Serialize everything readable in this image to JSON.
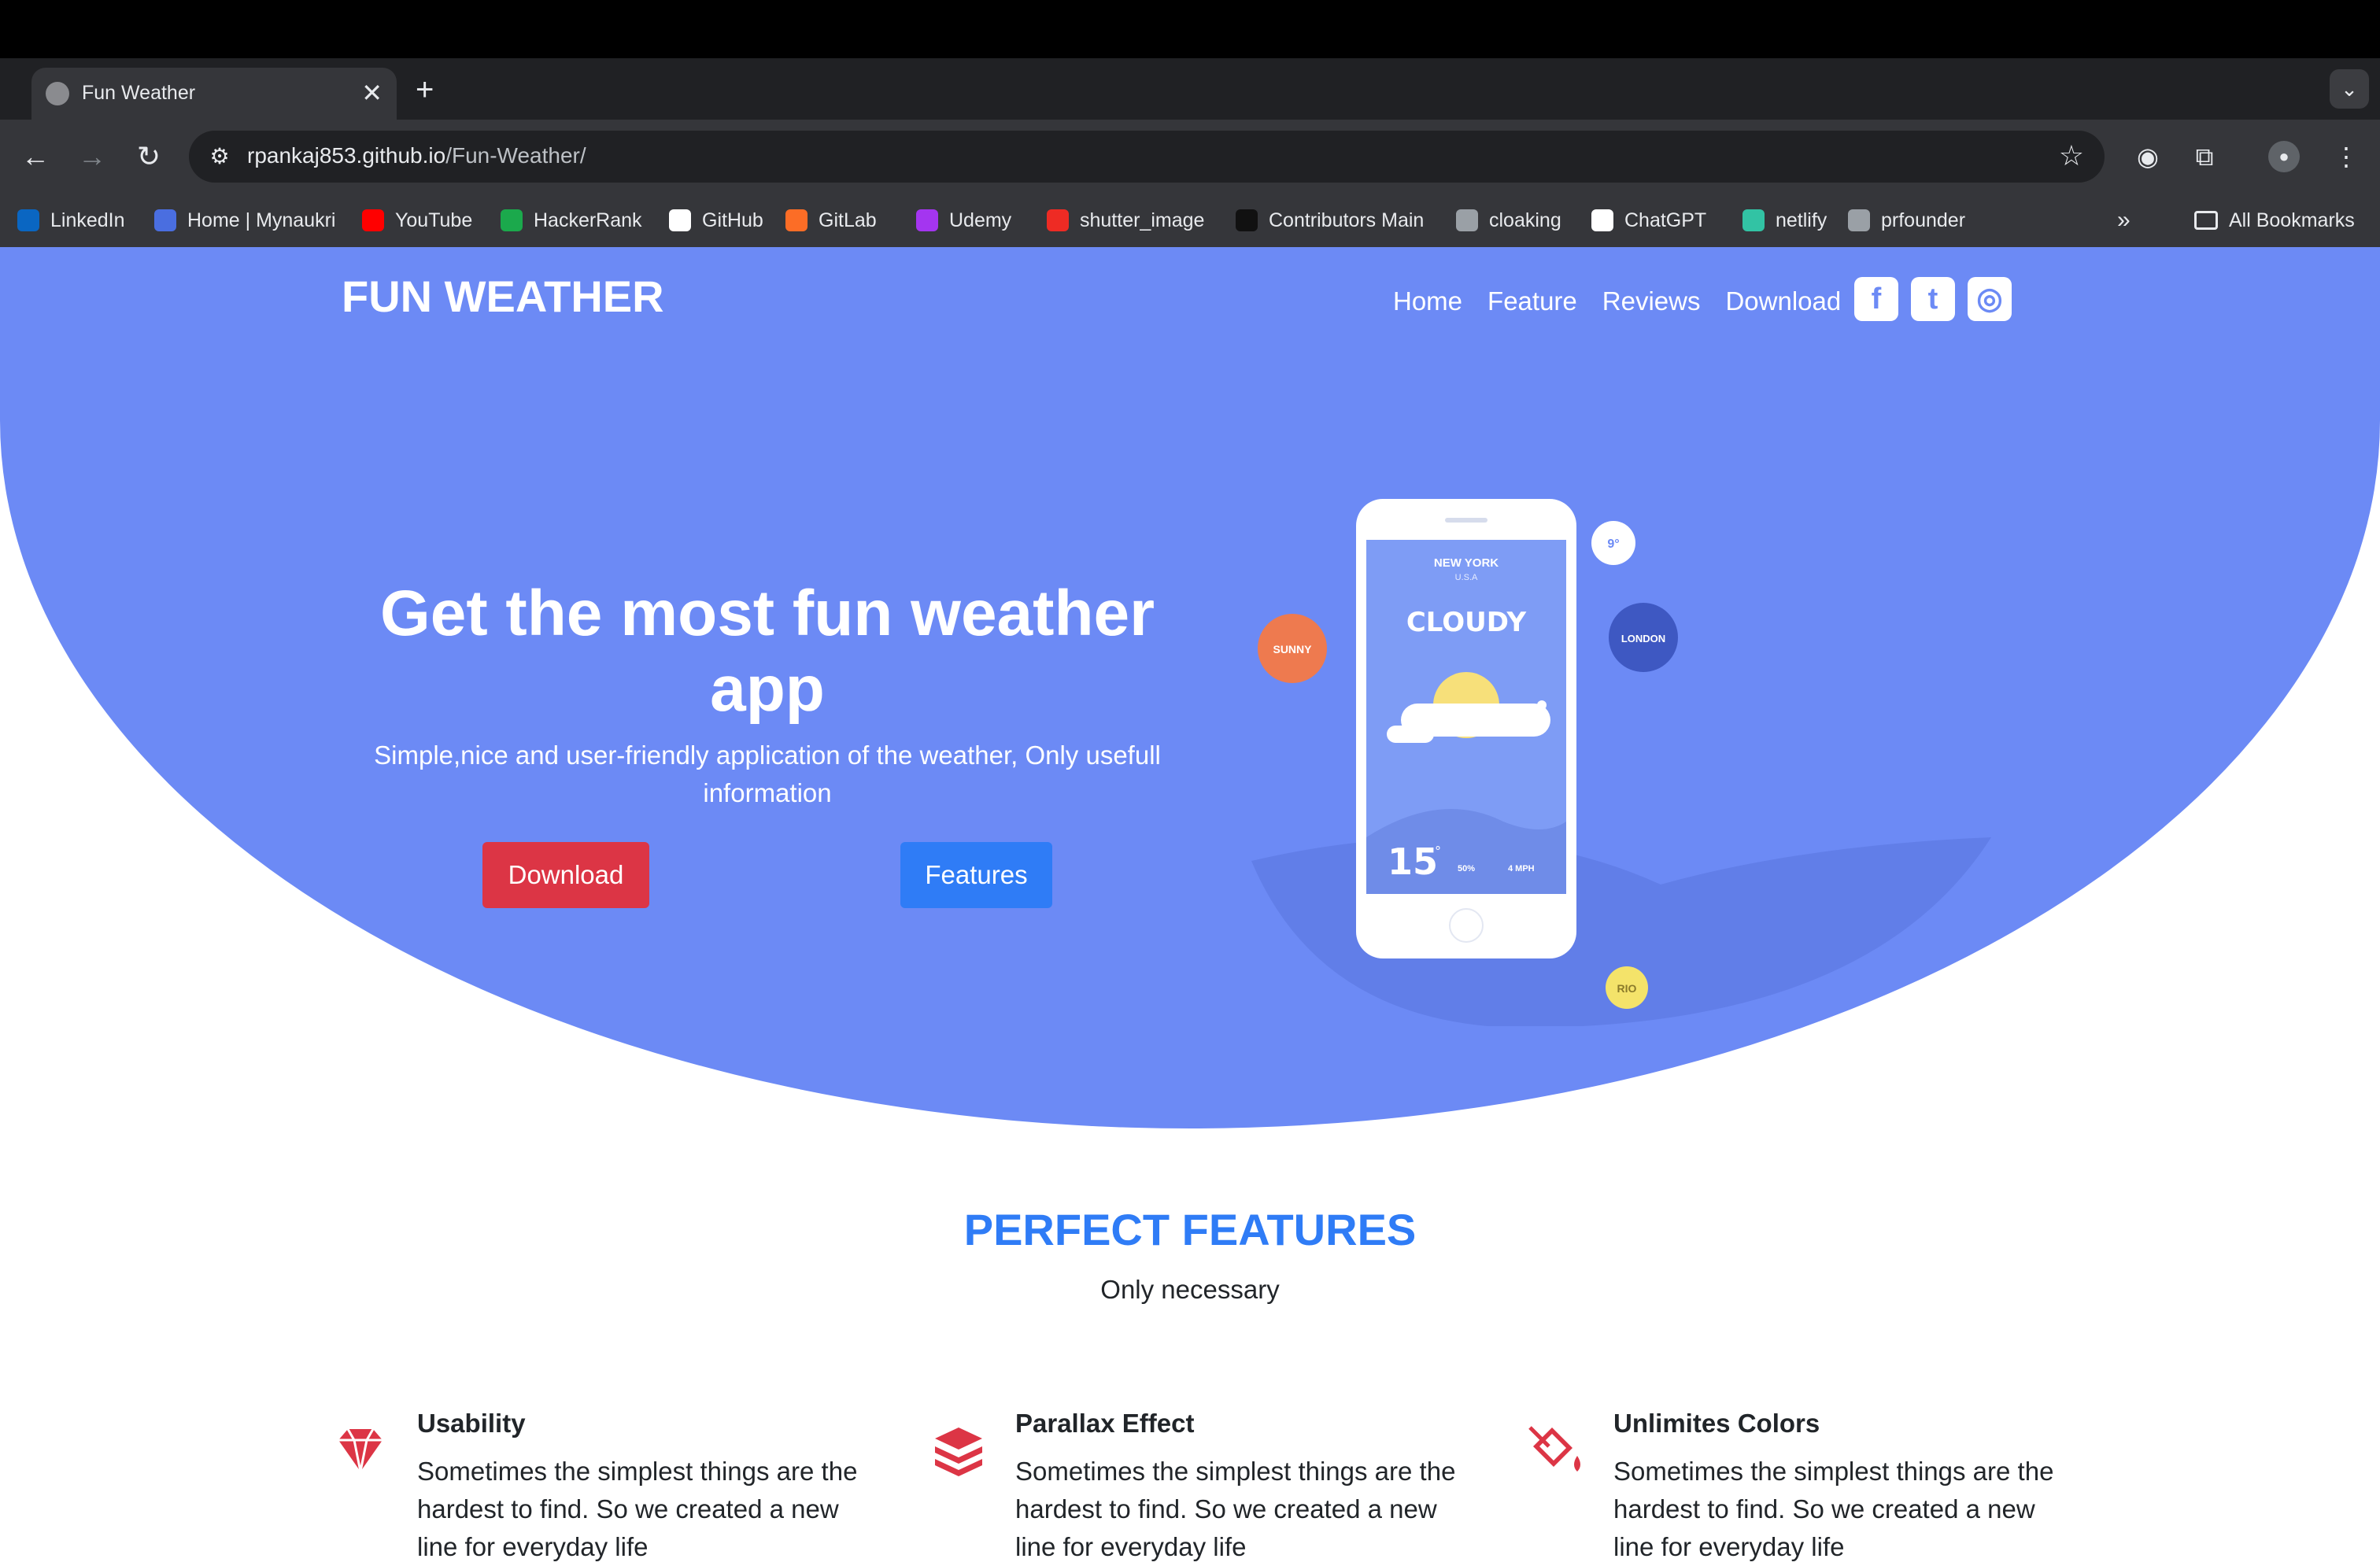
{
  "browser": {
    "tab_title": "Fun Weather",
    "tab_close": "✕",
    "new_tab": "+",
    "url_host": "rpankaj853.github.io",
    "url_path": "/Fun-Weather/",
    "bookmarks": [
      {
        "label": "LinkedIn",
        "color": "#0a66c2"
      },
      {
        "label": "Home | Mynaukri",
        "color": "#4a6ee0"
      },
      {
        "label": "YouTube",
        "color": "#ff0000"
      },
      {
        "label": "HackerRank",
        "color": "#1ba94c"
      },
      {
        "label": "GitHub",
        "color": "#ffffff"
      },
      {
        "label": "GitLab",
        "color": "#fc6d26"
      },
      {
        "label": "Udemy",
        "color": "#a435f0"
      },
      {
        "label": "shutter_image",
        "color": "#ee2b24"
      },
      {
        "label": "Contributors Main",
        "color": "#111111"
      },
      {
        "label": "cloaking",
        "color": "#9aa0a6"
      },
      {
        "label": "ChatGPT",
        "color": "#ffffff"
      },
      {
        "label": "netlify",
        "color": "#32c3a4"
      },
      {
        "label": "prfounder",
        "color": "#9aa0a6"
      }
    ],
    "all_bookmarks": "All Bookmarks",
    "more_bookmarks": "»"
  },
  "site": {
    "brand": "FUN WEATHER",
    "nav": [
      "Home",
      "Feature",
      "Reviews",
      "Download"
    ],
    "social": [
      {
        "icon": "facebook-icon",
        "glyph": "f"
      },
      {
        "icon": "twitter-icon",
        "glyph": "t"
      },
      {
        "icon": "instagram-icon",
        "glyph": "◎"
      }
    ],
    "hero": {
      "headline_line1": "Get the most fun weather",
      "headline_line2": "app",
      "subtitle_line1": "Simple,nice and user-friendly application of the weather, Only usefull",
      "subtitle_line2": "information",
      "download_button": "Download",
      "features_button": "Features"
    },
    "phone": {
      "city": "NEW YORK",
      "country": "U.S.A",
      "condition": "CLOUDY",
      "temperature": "15",
      "degree": "°",
      "humidity": "50%",
      "wind": "4 MPH",
      "bubbles": {
        "small_temp": "9°",
        "sunny": "SUNNY",
        "london": "LONDON",
        "rio": "RIO"
      }
    },
    "features_section": {
      "title": "PERFECT FEATURES",
      "subtitle": "Only necessary",
      "items": [
        {
          "title": "Usability",
          "text": "Sometimes the simplest things are the hardest to find. So we created a new line for everyday life",
          "icon": "gem-icon"
        },
        {
          "title": "Parallax Effect",
          "text": "Sometimes the simplest things are the hardest to find. So we created a new line for everyday life",
          "icon": "layers-icon"
        },
        {
          "title": "Unlimites Colors",
          "text": "Sometimes the simplest things are the hardest to find. So we created a new line for everyday life",
          "icon": "paint-bucket-icon"
        }
      ]
    }
  },
  "colors": {
    "hero": "#6c8af5",
    "accent_blue": "#2f7cf6",
    "accent_red": "#dc3545"
  }
}
